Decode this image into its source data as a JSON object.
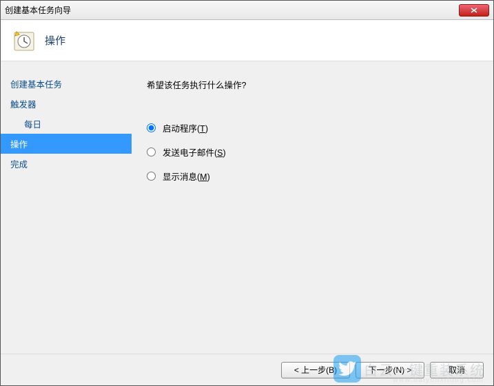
{
  "titlebar": {
    "title": "创建基本任务向导"
  },
  "header": {
    "title": "操作"
  },
  "sidebar": {
    "items": [
      {
        "label": "创建基本任务",
        "cls": ""
      },
      {
        "label": "触发器",
        "cls": ""
      },
      {
        "label": "每日",
        "cls": "sub"
      },
      {
        "label": "操作",
        "cls": "selected"
      },
      {
        "label": "完成",
        "cls": ""
      }
    ]
  },
  "content": {
    "question": "希望该任务执行什么操作?",
    "options": [
      {
        "pre": "启动程序(",
        "u": "T",
        "post": ")",
        "checked": true
      },
      {
        "pre": "发送电子邮件(",
        "u": "S",
        "post": ")",
        "checked": false
      },
      {
        "pre": "显示消息(",
        "u": "M",
        "post": ")",
        "checked": false
      }
    ]
  },
  "footer": {
    "back": "< 上一步(B)",
    "next": "下一步(N) >",
    "cancel": "取消"
  },
  "watermark": {
    "brand": "白云一键重装系统",
    "url": "www.baiyunxitong.com"
  }
}
